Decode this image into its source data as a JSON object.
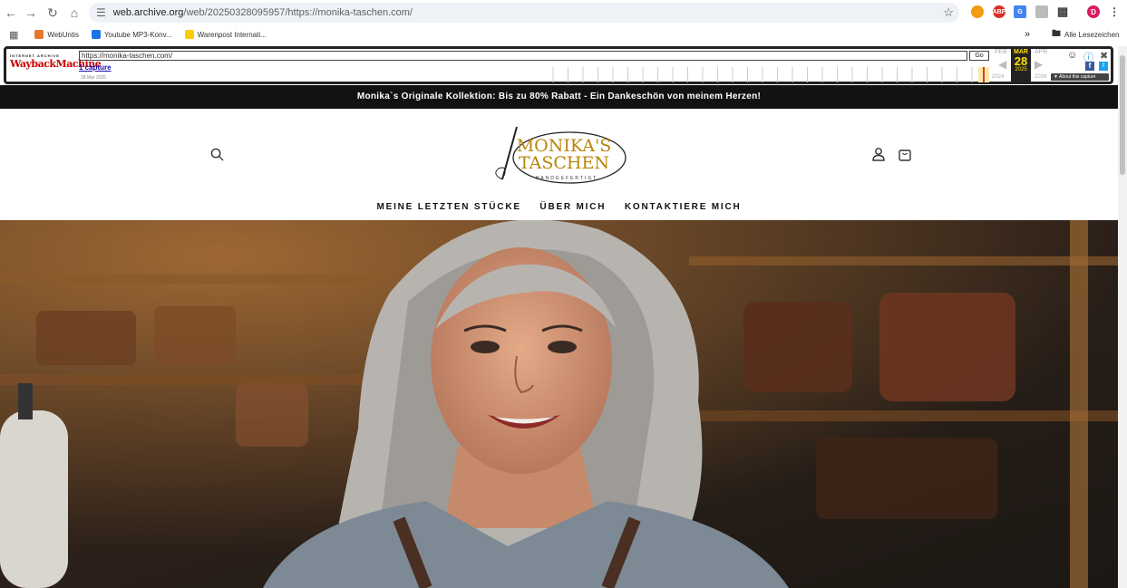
{
  "browser": {
    "url_host": "web.archive.org",
    "url_path": "/web/20250328095957/https://monika-taschen.com/",
    "bookmarks": [
      {
        "label": "WebUntis",
        "color": "#e8772e"
      },
      {
        "label": "Youtube MP3-Konv...",
        "color": "#1a73e8"
      },
      {
        "label": "Warenpost Internati...",
        "color": "#ffcc00"
      }
    ],
    "bookmarks_overflow": "»",
    "all_bookmarks": "Alle Lesezeichen",
    "profile_initial": "D"
  },
  "wayback": {
    "logo_top": "INTERNET ARCHIVE",
    "logo_main": "WaybackMachine",
    "url_value": "https://monika-taschen.com/",
    "go_label": "Go",
    "captures": "1 capture",
    "capture_date": "28 Mar 2025",
    "prev_month": "FEB",
    "cur_month": "MAR",
    "next_month": "APR",
    "day": "28",
    "prev_year": "2024",
    "cur_year": "2025",
    "next_year": "2026",
    "about": "▼ About this capture"
  },
  "site": {
    "announcement": "Monika`s Originale Kollektion: Bis zu 80% Rabatt - Ein Dankeschön von meinem Herzen!",
    "logo_line1": "MONIKA'S",
    "logo_line2": "TASCHEN",
    "logo_sub": "HANDGEFERTIGT",
    "nav": [
      "MEINE LETZTEN STÜCKE",
      "ÜBER MICH",
      "KONTAKTIERE MICH"
    ]
  }
}
